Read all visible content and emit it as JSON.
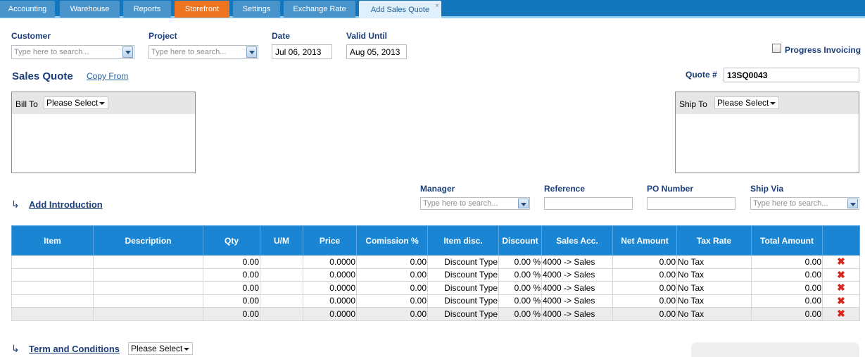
{
  "tabs": [
    {
      "label": "Accounting"
    },
    {
      "label": "Warehouse"
    },
    {
      "label": "Reports"
    },
    {
      "label": "Storefront"
    },
    {
      "label": "Settings"
    },
    {
      "label": "Exchange Rate"
    },
    {
      "label": "Add Sales Quote",
      "close": "×"
    }
  ],
  "form": {
    "customer_label": "Customer",
    "customer_placeholder": "Type here to search...",
    "project_label": "Project",
    "project_placeholder": "Type here to search...",
    "date_label": "Date",
    "date_value": "Jul 06, 2013",
    "valid_label": "Valid Until",
    "valid_value": "Aug 05, 2013",
    "progress_label": "Progress Invoicing",
    "title": "Sales Quote",
    "copy_from": "Copy From",
    "quote_label": "Quote #",
    "quote_value": "13SQ0043",
    "bill_to": "Bill To",
    "ship_to": "Ship To",
    "please_select": "Please Select",
    "add_intro": "Add Introduction",
    "manager_label": "Manager",
    "manager_placeholder": "Type here to search...",
    "reference_label": "Reference",
    "po_label": "PO Number",
    "shipvia_label": "Ship Via",
    "shipvia_placeholder": "Type here to search...",
    "terms": "Term and Conditions"
  },
  "grid": {
    "headers": [
      "Item",
      "Description",
      "Qty",
      "U/M",
      "Price",
      "Comission %",
      "Item disc.",
      "Discount",
      "Sales Acc.",
      "Net Amount",
      "Tax Rate",
      "Total Amount"
    ],
    "rows": [
      [
        "",
        "",
        "0.00",
        "",
        "0.0000",
        "0.00",
        "Discount Type",
        "0.00 %",
        "4000 -> Sales",
        "0.00",
        "No Tax",
        "0.00"
      ],
      [
        "",
        "",
        "0.00",
        "",
        "0.0000",
        "0.00",
        "Discount Type",
        "0.00 %",
        "4000 -> Sales",
        "0.00",
        "No Tax",
        "0.00"
      ],
      [
        "",
        "",
        "0.00",
        "",
        "0.0000",
        "0.00",
        "Discount Type",
        "0.00 %",
        "4000 -> Sales",
        "0.00",
        "No Tax",
        "0.00"
      ],
      [
        "",
        "",
        "0.00",
        "",
        "0.0000",
        "0.00",
        "Discount Type",
        "0.00 %",
        "4000 -> Sales",
        "0.00",
        "No Tax",
        "0.00"
      ],
      [
        "",
        "",
        "0.00",
        "",
        "0.0000",
        "0.00",
        "Discount Type",
        "0.00 %",
        "4000 -> Sales",
        "0.00",
        "No Tax",
        "0.00"
      ]
    ],
    "delete_glyph": "✖"
  },
  "colors": {
    "tabbar": "#1477bd",
    "active_tab": "#dff0fc",
    "storefront": "#ef7422",
    "header": "#1a86d3",
    "delete": "#d9261c"
  }
}
